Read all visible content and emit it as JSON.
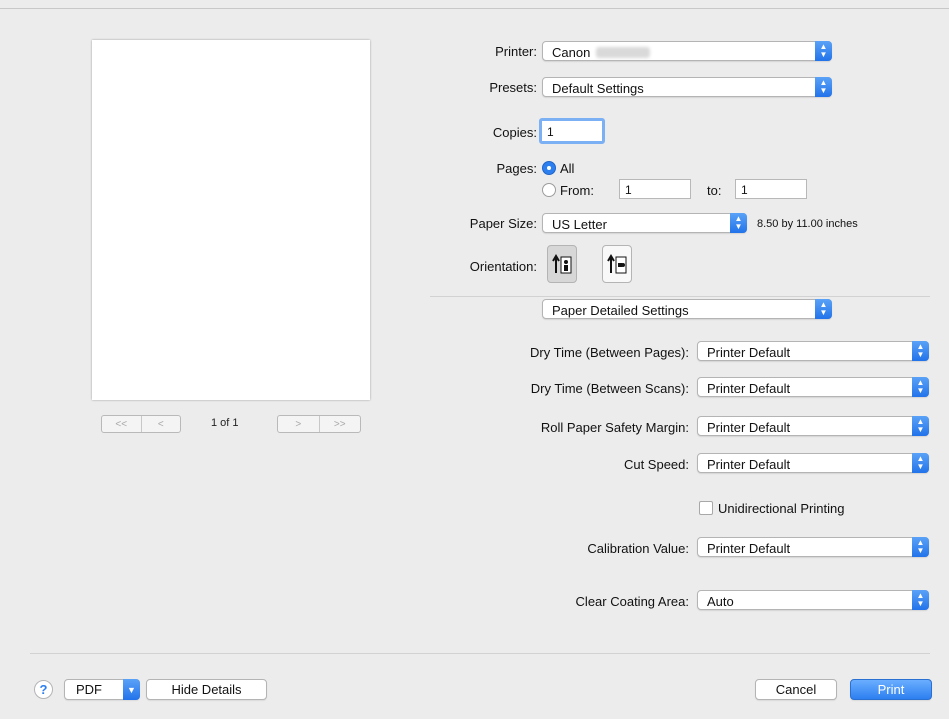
{
  "printer": {
    "label": "Printer:",
    "value": "Canon"
  },
  "presets": {
    "label": "Presets:",
    "value": "Default Settings"
  },
  "copies": {
    "label": "Copies:",
    "value": "1"
  },
  "pages": {
    "label": "Pages:",
    "all_label": "All",
    "from_label": "From:",
    "from_value": "1",
    "to_label": "to:",
    "to_value": "1"
  },
  "paper_size": {
    "label": "Paper Size:",
    "value": "US Letter",
    "dimensions": "8.50 by 11.00 inches"
  },
  "orientation": {
    "label": "Orientation:",
    "selected": "portrait"
  },
  "section_popup": {
    "value": "Paper Detailed Settings"
  },
  "settings": [
    {
      "label": "Dry Time (Between Pages):",
      "value": "Printer Default"
    },
    {
      "label": "Dry Time (Between Scans):",
      "value": "Printer Default"
    },
    {
      "label": "Roll Paper Safety Margin:",
      "value": "Printer Default"
    },
    {
      "label": "Cut Speed:",
      "value": "Printer Default"
    }
  ],
  "unidirectional": {
    "label": "Unidirectional Printing",
    "checked": false
  },
  "calibration": {
    "label": "Calibration Value:",
    "value": "Printer Default"
  },
  "clear_coating": {
    "label": "Clear Coating Area:",
    "value": "Auto"
  },
  "preview_nav": {
    "first": "<<",
    "prev": "<",
    "page_info": "1 of 1",
    "next": ">",
    "last": ">>"
  },
  "footer": {
    "help": "?",
    "pdf": "PDF",
    "hide_details": "Hide Details",
    "cancel": "Cancel",
    "print": "Print"
  },
  "colors": {
    "accent": "#2d7ff0",
    "background": "#ececec"
  },
  "icons": {
    "popup_arrows": "up-down-chevrons-icon",
    "pdf_menu": "chevron-down-icon",
    "portrait": "portrait-orientation-icon",
    "landscape": "landscape-orientation-icon"
  }
}
